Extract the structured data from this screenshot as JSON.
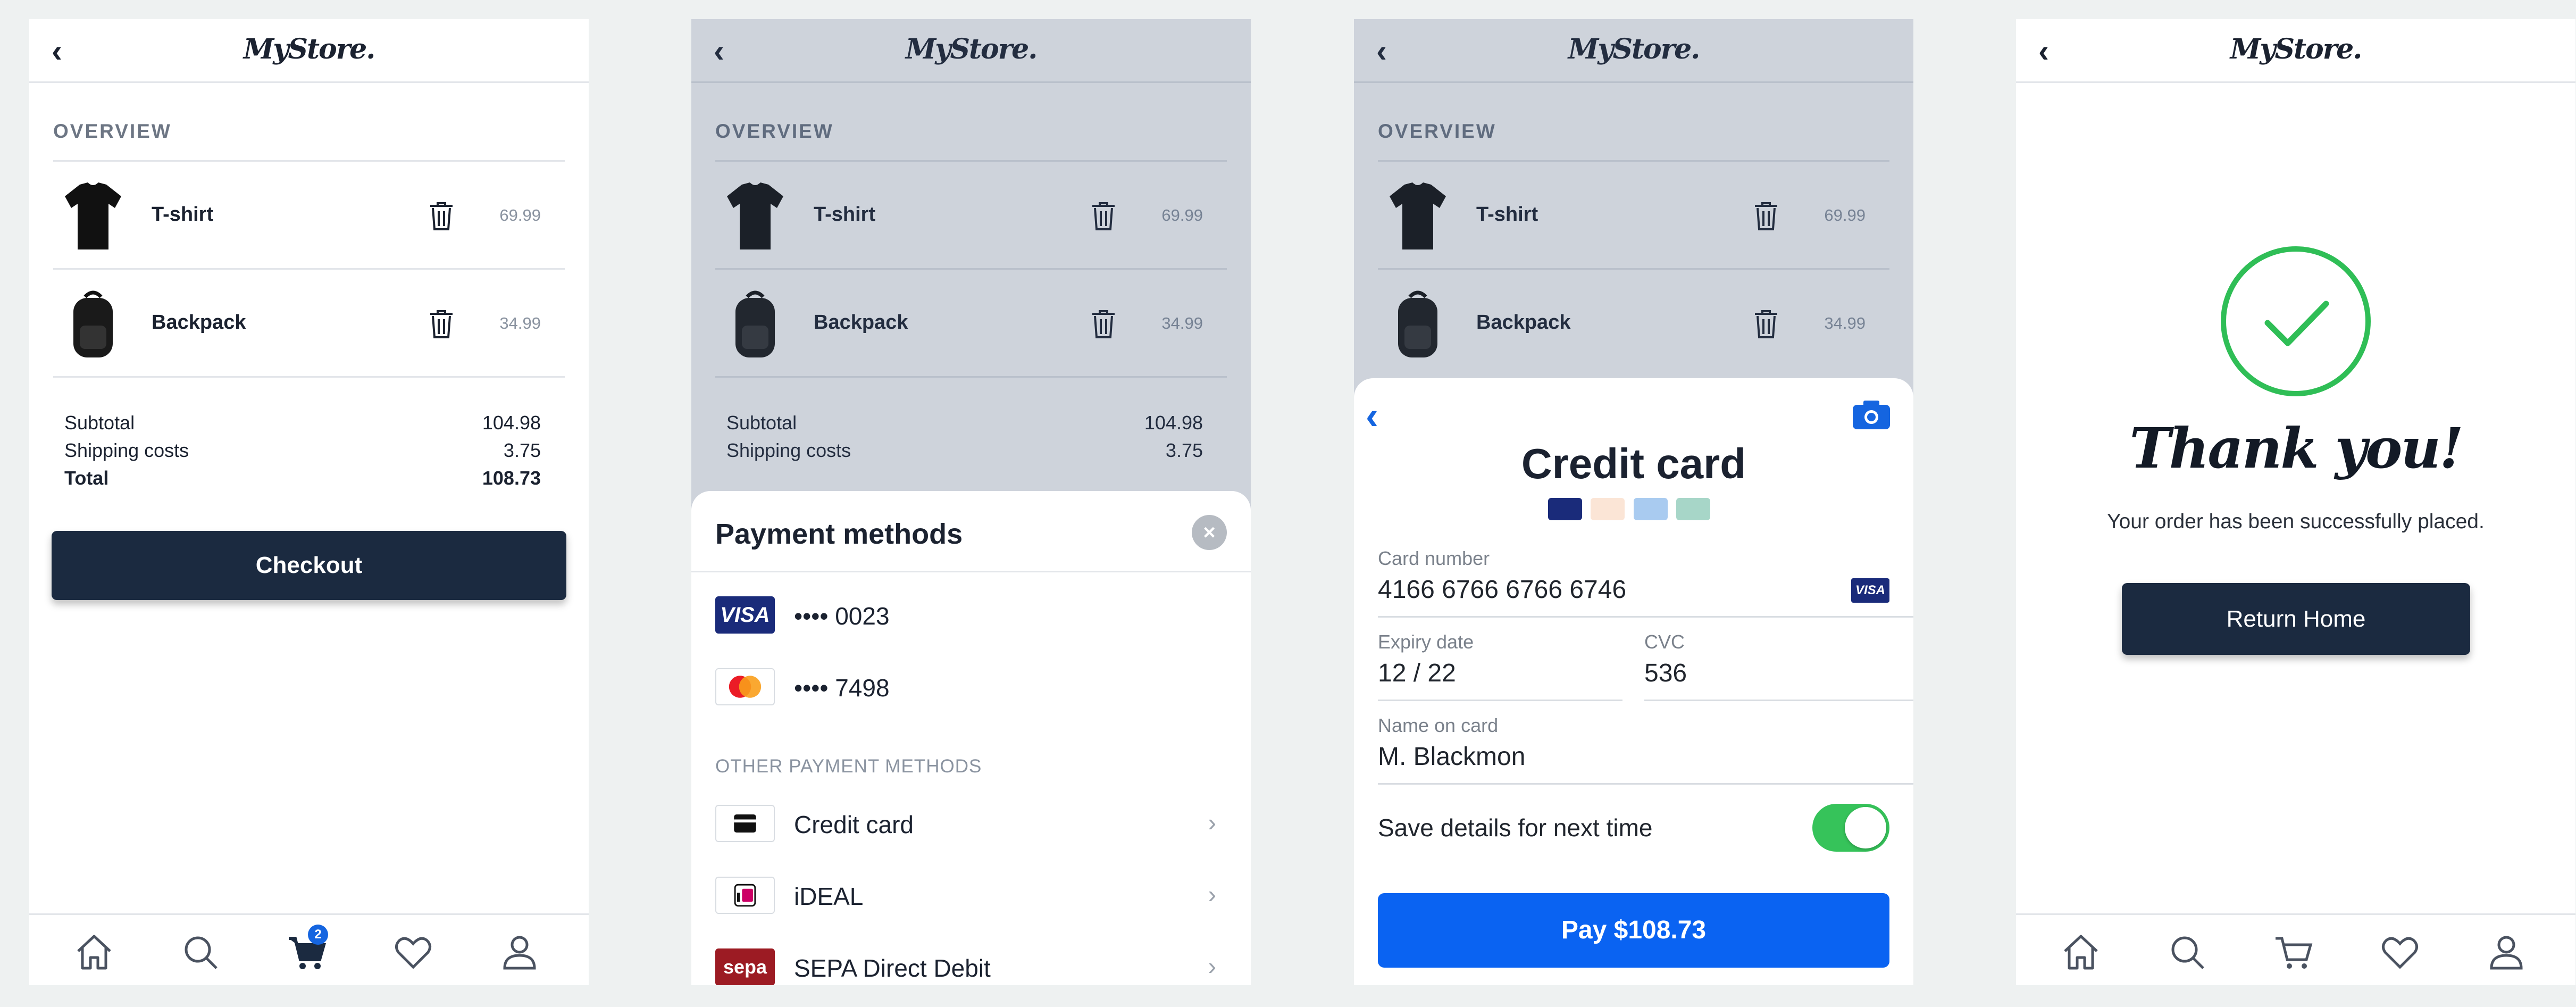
{
  "brand": {
    "logo_text": "MyStore."
  },
  "colors": {
    "primary_dark": "#1b2a40",
    "accent_blue": "#0a63f2",
    "success_green": "#2fbe56",
    "background": "#eef1f1"
  },
  "overview": {
    "heading": "OVERVIEW",
    "items": [
      {
        "name": "T-shirt",
        "price": "69.99",
        "icon": "tshirt-icon"
      },
      {
        "name": "Backpack",
        "price": "34.99",
        "icon": "backpack-icon"
      }
    ],
    "subtotal_label": "Subtotal",
    "subtotal_value": "104.98",
    "shipping_label": "Shipping costs",
    "shipping_value": "3.75",
    "total_label": "Total",
    "total_value": "108.73",
    "checkout_label": "Checkout"
  },
  "tabbar": {
    "items": [
      "home-icon",
      "search-icon",
      "cart-icon",
      "heart-icon",
      "profile-icon"
    ],
    "cart_badge": "2"
  },
  "payment_methods": {
    "title": "Payment methods",
    "saved": [
      {
        "brand": "VISA",
        "label": "•••• 0023"
      },
      {
        "brand": "mastercard",
        "label": "•••• 7498"
      }
    ],
    "other_heading": "OTHER PAYMENT METHODS",
    "other": [
      {
        "label": "Credit card",
        "icon": "credit-card-icon"
      },
      {
        "label": "iDEAL",
        "icon": "ideal-icon"
      },
      {
        "label": "SEPA Direct Debit",
        "icon": "sepa-icon",
        "logo_text": "sepa"
      }
    ]
  },
  "credit_card": {
    "title": "Credit card",
    "card_number_label": "Card number",
    "card_number_value": "4166 6766 6766 6746",
    "card_brand": "VISA",
    "expiry_label": "Expiry date",
    "expiry_value": "12 / 22",
    "cvc_label": "CVC",
    "cvc_value": "536",
    "name_label": "Name on card",
    "name_value": "M. Blackmon",
    "save_label": "Save details for next time",
    "save_enabled": true,
    "pay_label": "Pay $108.73"
  },
  "confirmation": {
    "thanks": "Thank you!",
    "message": "Your order has been successfully placed.",
    "button_label": "Return Home"
  }
}
